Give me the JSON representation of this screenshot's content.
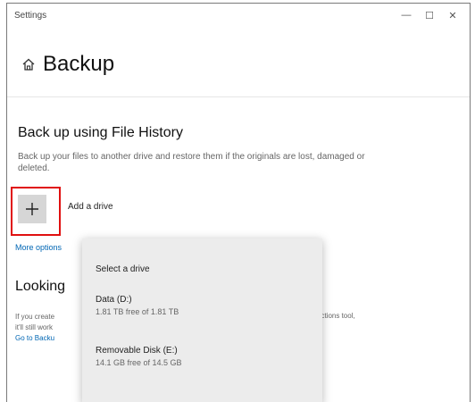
{
  "window": {
    "title": "Settings",
    "controls": {
      "minimize": "—",
      "maximize": "☐",
      "close": "✕"
    }
  },
  "page": {
    "title": "Backup",
    "icon": "home-icon"
  },
  "file_history": {
    "title": "Back up using File History",
    "description": "Back up your files to another drive and restore them if the originals are lost, damaged or deleted.",
    "add_drive_label": "Add a drive",
    "add_icon": "plus-icon",
    "more_options": "More options"
  },
  "looking": {
    "title": "Looking",
    "desc_line1": "If you create",
    "desc_line2": "it'll still work",
    "desc_right": "ections tool,",
    "link": "Go to Backu"
  },
  "flyout": {
    "title": "Select a drive",
    "drives": [
      {
        "name": "Data (D:)",
        "space": "1.81 TB free of 1.81 TB"
      },
      {
        "name": "Removable Disk (E:)",
        "space": "14.1 GB free of 14.5 GB"
      }
    ]
  },
  "colors": {
    "accent": "#0066b4",
    "highlight": "#e01010",
    "flyout_bg": "#ececec"
  }
}
